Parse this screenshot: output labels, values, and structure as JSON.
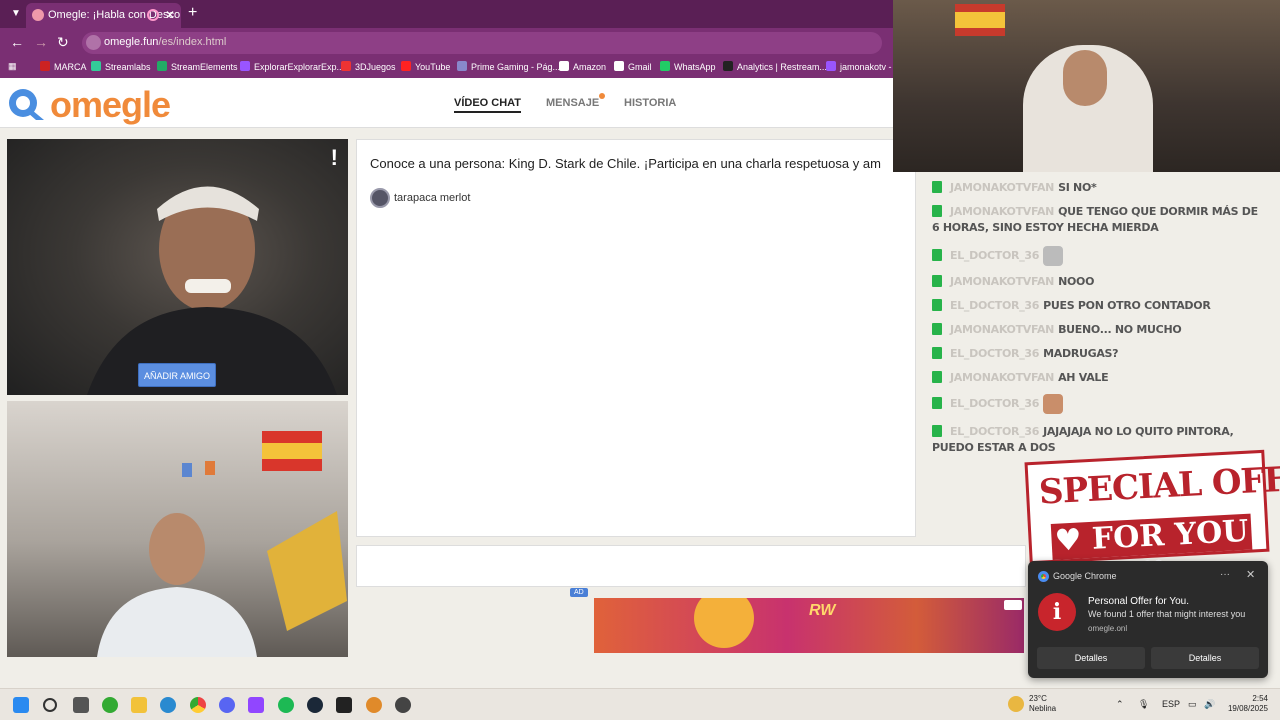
{
  "browser": {
    "tab": {
      "title": "Omegle: ¡Habla con Desco"
    },
    "url": {
      "host": "omegle.fun",
      "path": "/es/index.html"
    },
    "bookmarks": [
      "MARCA",
      "Streamlabs",
      "StreamElements",
      "ExplorarExplorarExp...",
      "3DJuegos",
      "YouTube",
      "Prime Gaming - Pág...",
      "Amazon",
      "Gmail",
      "WhatsApp",
      "Analytics | Restream...",
      "jamonakotv - T"
    ]
  },
  "site": {
    "logo": "omegle",
    "nav": {
      "video_chat": "VÍDEO CHAT",
      "message": "MENSAJE",
      "history": "HISTORIA"
    }
  },
  "stranger_video": {
    "report_glyph": "!",
    "add_friend": "AÑADIR AMIGO"
  },
  "chat": {
    "intro": "Conoce a una persona: King D. Stark de Chile. ¡Participa en una charla respetuosa y am",
    "user": "tarapaca merlot"
  },
  "ad": {
    "label": "AD",
    "brand": "RW"
  },
  "stream_chat": {
    "messages": [
      {
        "user": "JAMONAKOTVFAN",
        "text": "SI NO*"
      },
      {
        "user": "JAMONAKOTVFAN",
        "text": "QUE TENGO QUE DORMIR MÁS DE 6 HORAS, SINO ESTOY HECHA MIERDA"
      },
      {
        "user": "EL_DOCTOR_36",
        "text": "",
        "emote": "cat-emote"
      },
      {
        "user": "JAMONAKOTVFAN",
        "text": "NOOO"
      },
      {
        "user": "EL_DOCTOR_36",
        "text": "PUES PON OTRO CONTADOR"
      },
      {
        "user": "JAMONAKOTVFAN",
        "text": "BUENO... NO MUCHO"
      },
      {
        "user": "EL_DOCTOR_36",
        "text": "MADRUGAS?"
      },
      {
        "user": "JAMONAKOTVFAN",
        "text": "AH VALE"
      },
      {
        "user": "EL_DOCTOR_36",
        "text": "",
        "emote": "face-emote"
      },
      {
        "user": "EL_DOCTOR_36",
        "text": "JAJAJAJA NO LO QUITO PINTORA, PUEDO ESTAR A DOS"
      }
    ]
  },
  "special_offer": {
    "line1": "SPECIAL OFFER",
    "line2": "♥ FOR YOU ♥"
  },
  "notification": {
    "app": "Google Chrome",
    "title": "Personal Offer for You.",
    "body": "We found 1 offer that might interest you",
    "source": "omegle.onl",
    "button1": "Detalles",
    "button2": "Detalles"
  },
  "taskbar": {
    "weather_temp": "23°C",
    "weather_desc": "Neblina",
    "lang": "ESP",
    "time": "2:54",
    "date": "19/08/2025"
  },
  "colors": {
    "accent": "#f08a3a",
    "brand_blue": "#4a7fd6",
    "chrome_purple": "#7a2f73",
    "chat_badge": "#27b34a"
  }
}
